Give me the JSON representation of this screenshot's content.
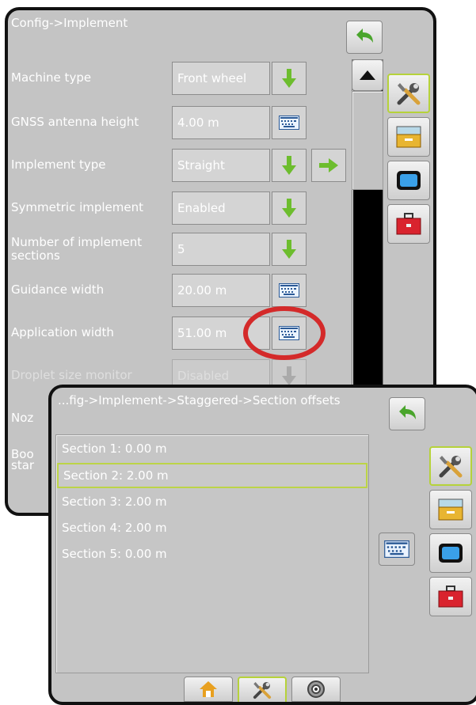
{
  "back_panel": {
    "title": "Config->Implement",
    "rows": [
      {
        "label": "Machine type",
        "value": "Front wheel",
        "control": "dropdown"
      },
      {
        "label": "GNSS antenna height",
        "value": "4.00 m",
        "control": "keyboard"
      },
      {
        "label": "Implement type",
        "value": "Straight",
        "control": "dropdown"
      },
      {
        "label": "Symmetric implement",
        "value": "Enabled",
        "control": "dropdown"
      },
      {
        "label": "Number of implement sections",
        "value": "5",
        "control": "dropdown"
      },
      {
        "label": "Guidance width",
        "value": "20.00 m",
        "control": "keyboard"
      },
      {
        "label": "Application width",
        "value": "51.00 m",
        "control": "keyboard"
      },
      {
        "label": "Droplet size monitor",
        "value": "Disabled",
        "control": "dropdown"
      }
    ],
    "partial_labels": [
      "Noz",
      "Boo",
      "star"
    ]
  },
  "front_panel": {
    "title": "...fig->Implement->Staggered->Section offsets",
    "sections": [
      "Section 1: 0.00 m",
      "Section 2: 2.00 m",
      "Section 3: 2.00 m",
      "Section 4: 2.00 m",
      "Section 5: 0.00 m"
    ],
    "selected_index": 1
  },
  "icons": {
    "back": "back-arrow-icon",
    "tools": "tools-icon",
    "console": "console-icon",
    "display": "display-icon",
    "toolbox": "toolbox-icon",
    "keyboard": "keyboard-icon",
    "home": "home-icon",
    "gnss": "gnss-icon"
  },
  "colors": {
    "panel": "#c4c4c4",
    "accent_green": "#6dbd2e",
    "selection": "#bcd447",
    "highlight_circle": "#d42a2a"
  }
}
